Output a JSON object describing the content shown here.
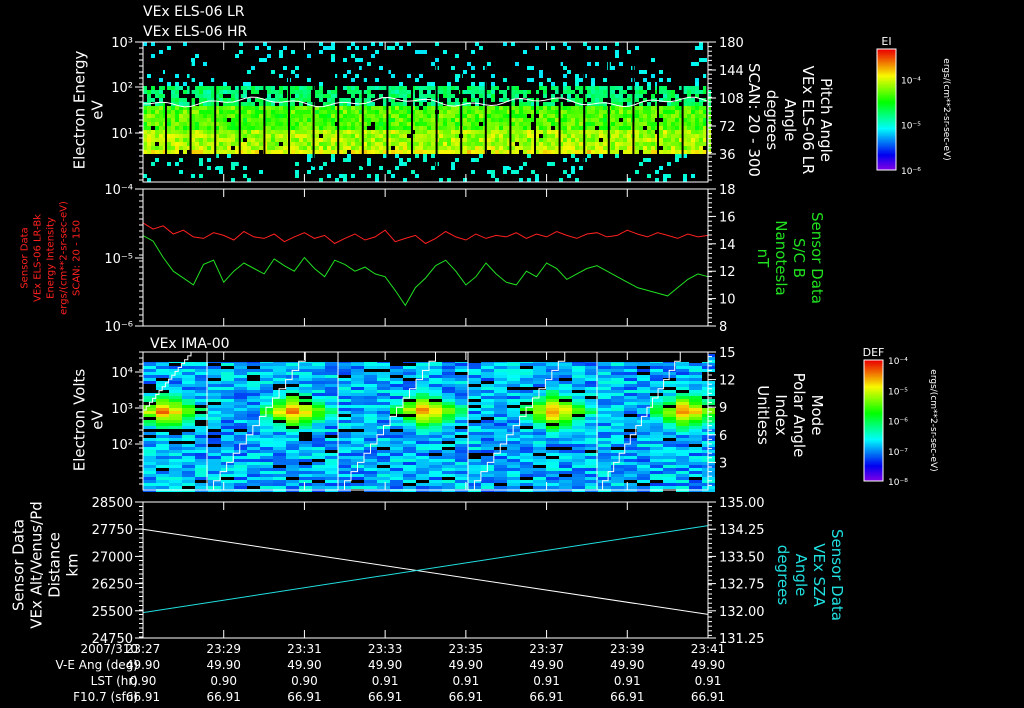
{
  "header": {
    "line1": "VEx ELS-06 LR",
    "line2": "VEx ELS-06 HR"
  },
  "colors": {
    "white": "#ffffff",
    "red": "#ff2020",
    "green": "#20e020",
    "cyan": "#20e0e0"
  },
  "chart_data": [
    {
      "type": "heatmap",
      "panel": "els",
      "ylabel_left": [
        "Electron Energy",
        "eV"
      ],
      "yticks_left": [
        "10³",
        "10²",
        "10¹"
      ],
      "yticks_left_values": [
        1000,
        100,
        10
      ],
      "ylim_left_log10": [
        -0.1,
        3
      ],
      "ylabel_right": [
        "Pitch Angle",
        "VEx ELS-06 LR",
        "Angle",
        "degrees",
        "SCAN: 20 - 300"
      ],
      "yticks_right": [
        "180",
        "144",
        "108",
        "72",
        "36"
      ],
      "yticks_right_values": [
        180,
        144,
        108,
        72,
        36
      ],
      "ylim_right": [
        0,
        180
      ],
      "colorbar": {
        "title": "EI",
        "ticks": [
          "10⁻⁴",
          "10⁻⁵",
          "10⁻⁶"
        ],
        "units": "ergs/(cm**2-sr-sec-eV)"
      }
    },
    {
      "type": "line",
      "panel": "sensor",
      "ylabel_left": [
        "Sensor Data",
        "VEx ELS-06 LR-Bk",
        "Energy Intensity",
        "ergs/(cm**2-sr-sec-eV)",
        "SCAN: 20 - 150"
      ],
      "yticks_left": [
        "10⁻⁴",
        "10⁻⁵",
        "10⁻⁶"
      ],
      "ylim_left": [
        1e-06,
        0.0001
      ],
      "ylabel_right": [
        "Sensor Data",
        "S/C B",
        "Nanotesla",
        "nT"
      ],
      "yticks_right": [
        "18",
        "16",
        "14",
        "12",
        "10",
        "8"
      ],
      "ylim_right": [
        8,
        18
      ],
      "series": [
        {
          "name": "Energy Intensity",
          "axis": "left",
          "color": "#ff2020",
          "values": [
            3.2e-05,
            2.6e-05,
            2.9e-05,
            2.2e-05,
            2.5e-05,
            2e-05,
            1.9e-05,
            2.3e-05,
            2.1e-05,
            1.8e-05,
            2.4e-05,
            2e-05,
            1.9e-05,
            2.2e-05,
            1.7e-05,
            2e-05,
            2.3e-05,
            1.9e-05,
            2.1e-05,
            1.6e-05,
            1.9e-05,
            2.2e-05,
            1.8e-05,
            2e-05,
            2.5e-05,
            1.7e-05,
            1.9e-05,
            2.1e-05,
            1.6e-05,
            1.9e-05,
            2.4e-05,
            2e-05,
            1.8e-05,
            2.2e-05,
            1.9e-05,
            2.1e-05,
            2e-05,
            2.3e-05,
            1.9e-05,
            2.2e-05,
            2e-05,
            2.4e-05,
            2.1e-05,
            1.9e-05,
            2.2e-05,
            2.3e-05,
            2e-05,
            2.1e-05,
            2.5e-05,
            2.2e-05,
            2e-05,
            2.3e-05,
            2.1e-05,
            1.9e-05,
            2.2e-05,
            2e-05,
            2.1e-05
          ]
        },
        {
          "name": "S/C B",
          "axis": "right",
          "color": "#20e020",
          "values": [
            14.6,
            14.2,
            13.0,
            12.0,
            11.5,
            11.0,
            12.5,
            12.8,
            11.2,
            12.0,
            12.6,
            12.2,
            11.8,
            12.9,
            12.4,
            12.0,
            13.0,
            12.2,
            11.6,
            12.8,
            12.5,
            12.0,
            12.3,
            11.8,
            11.6,
            10.6,
            9.5,
            10.8,
            11.5,
            12.4,
            12.8,
            12.0,
            11.0,
            11.6,
            12.6,
            11.8,
            11.2,
            11.0,
            12.0,
            11.6,
            12.6,
            12.2,
            11.4,
            11.8,
            12.2,
            12.4,
            12.0,
            11.6,
            11.2,
            10.8,
            10.6,
            10.4,
            10.2,
            10.8,
            11.4,
            11.8,
            11.6
          ]
        }
      ]
    },
    {
      "type": "heatmap",
      "panel": "ima",
      "title": "VEx IMA-00",
      "ylabel_left": [
        "Electron Volts",
        "eV"
      ],
      "yticks_left": [
        "10⁴",
        "10³",
        "10²"
      ],
      "ylim_left_log10": [
        0.72,
        4.56
      ],
      "ylabel_right": [
        "Mode",
        "Polar Angle",
        "Index",
        "Unitless"
      ],
      "yticks_right": [
        "15",
        "12",
        "9",
        "6",
        "3"
      ],
      "ylim_right": [
        0,
        15
      ],
      "colorbar": {
        "title": "DEF",
        "ticks": [
          "10⁻⁴",
          "10⁻⁵",
          "10⁻⁶",
          "10⁻⁷",
          "10⁻⁸"
        ],
        "units": "ergs/(cm**2-sr-sec-eV)"
      }
    },
    {
      "type": "line",
      "panel": "distance",
      "ylabel_left": [
        "Sensor Data",
        "VEx Alt/Venus/Pd",
        "Distance",
        "km"
      ],
      "yticks_left": [
        "28500",
        "27750",
        "27000",
        "26250",
        "25500",
        "24750"
      ],
      "ylim_left": [
        24750,
        28500
      ],
      "ylabel_right": [
        "Sensor Data",
        "VEx SZA",
        "Angle",
        "degrees"
      ],
      "yticks_right": [
        "135.00",
        "134.25",
        "133.50",
        "132.75",
        "132.00",
        "131.25"
      ],
      "ylim_right": [
        131.25,
        135.0
      ],
      "series": [
        {
          "name": "Distance",
          "axis": "left",
          "color": "#ffffff",
          "values": [
            27750,
            25400
          ]
        },
        {
          "name": "SZA",
          "axis": "right",
          "color": "#20e0e0",
          "values": [
            131.95,
            134.35
          ]
        }
      ]
    }
  ],
  "time_axis": {
    "row_labels": [
      "2007/310",
      "V-E Ang (deg)",
      "LST (hr)",
      "F10.7 (sfu)"
    ],
    "times": [
      "23:27",
      "23:29",
      "23:31",
      "23:33",
      "23:35",
      "23:37",
      "23:39",
      "23:41"
    ],
    "ve_ang": [
      "49.90",
      "49.90",
      "49.90",
      "49.90",
      "49.90",
      "49.90",
      "49.90",
      "49.90"
    ],
    "lst": [
      "0.90",
      "0.90",
      "0.90",
      "0.91",
      "0.91",
      "0.91",
      "0.91",
      "0.91"
    ],
    "f107": [
      "66.91",
      "66.91",
      "66.91",
      "66.91",
      "66.91",
      "66.91",
      "66.91",
      "66.91"
    ]
  }
}
